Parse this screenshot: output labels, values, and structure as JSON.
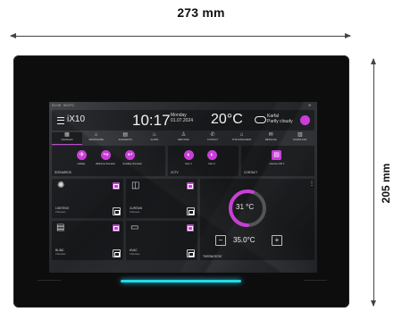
{
  "dimensions": {
    "width_label": "273 mm",
    "height_label": "205 mm"
  },
  "status_bar": {
    "time": "01:05",
    "indicator": "00:0°C",
    "wifi_icon": "wifi-icon"
  },
  "header": {
    "app_name": "iX10",
    "time": "10:17",
    "day": "Monday",
    "date": "01.07.2024",
    "temperature": "20°C",
    "city": "Karfal",
    "condition": "Partly cloudy"
  },
  "nav": [
    {
      "label": "Dashboard",
      "icon": "grid-icon",
      "glyph": "▦"
    },
    {
      "label": "SMARTHOME",
      "icon": "home-icon",
      "glyph": "⌂"
    },
    {
      "label": "SCENARIOS",
      "icon": "scenario-icon",
      "glyph": "▤"
    },
    {
      "label": "ALARM",
      "icon": "alarm-icon",
      "glyph": "♨"
    },
    {
      "label": "SERVICES",
      "icon": "bell-icon",
      "glyph": "♙"
    },
    {
      "label": "CONTACT",
      "icon": "phone-icon",
      "glyph": "✆"
    },
    {
      "label": "SITE MANAGERS",
      "icon": "building-icon",
      "glyph": "⌂"
    },
    {
      "label": "MESSAGE",
      "icon": "mail-icon",
      "glyph": "✉"
    },
    {
      "label": "DOWNLOAD",
      "icon": "download-icon",
      "glyph": "▥"
    }
  ],
  "scenarios": {
    "title": "SCENARIOS",
    "items": [
      "Holiday",
      "Welcome Scenario",
      "Goodbye Scenario"
    ]
  },
  "cctv": {
    "title": "CCTV",
    "items": [
      "Cam 1",
      "Cam 2"
    ]
  },
  "contact": {
    "title": "CONTACT",
    "items": [
      "Intercom INT 1"
    ]
  },
  "devices": [
    {
      "title": "LIGHTING",
      "status": "3 Devices",
      "icon": "lightbulb-icon"
    },
    {
      "title": "CURTAIN",
      "status": "3 Devices",
      "icon": "curtain-icon"
    },
    {
      "title": "BLIND",
      "status": "3 Devices",
      "icon": "blind-icon"
    },
    {
      "title": "HVAC",
      "status": "3 Devices",
      "icon": "hvac-icon"
    }
  ],
  "thermostat": {
    "title": "THERMOSTAT",
    "current": "31 °C",
    "setpoint": "35.0°C",
    "minus": "−",
    "plus": "+",
    "level": 0.55,
    "accent": "#c93ed8"
  },
  "colors": {
    "accent": "#c93ed8",
    "led": "#25d7e8",
    "bezel": "#0d0d0e"
  }
}
